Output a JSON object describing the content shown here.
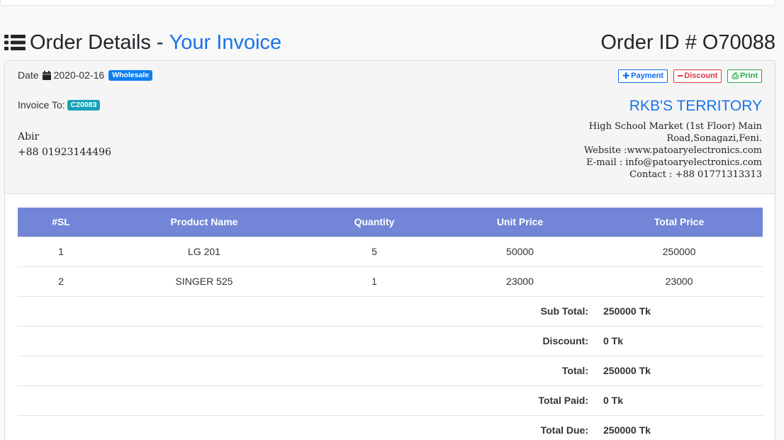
{
  "heading": {
    "title_main": "Order Details - ",
    "title_accent": "Your Invoice",
    "order_id": "Order ID # O70088"
  },
  "invoice": {
    "date_label": "Date",
    "date_value": "2020-02-16",
    "type_badge": "Wholesale",
    "invoice_to_label": "Invoice To:",
    "customer_code": "C20083",
    "customer_name": "Abir",
    "customer_phone": "+88 01923144496"
  },
  "actions": {
    "payment": "Payment",
    "discount": "Discount",
    "print": "Print"
  },
  "company": {
    "name": "RKB'S TERRITORY",
    "address_line1": "High School Market (1st Floor) Main",
    "address_line2": "Road,Sonagazi,Feni.",
    "website": "Website :www.patoaryelectronics.com",
    "email": "E-mail : info@patoaryelectronics.com",
    "contact": "Contact : +88 01771313313"
  },
  "table": {
    "headers": [
      "#SL",
      "Product Name",
      "Quantity",
      "Unit Price",
      "Total Price"
    ],
    "rows": [
      [
        "1",
        "LG 201",
        "5",
        "50000",
        "250000"
      ],
      [
        "2",
        "SINGER 525",
        "1",
        "23000",
        "23000"
      ]
    ]
  },
  "summary": {
    "sub_total_label": "Sub Total:",
    "sub_total_value": "250000 Tk",
    "discount_label": "Discount:",
    "discount_value": "0 Tk",
    "total_label": "Total:",
    "total_value": "250000 Tk",
    "paid_label": "Total Paid:",
    "paid_value": "0 Tk",
    "due_label": "Total Due:",
    "due_value": "250000 Tk"
  },
  "colors": {
    "accent": "#1a73e8",
    "table_header": "#7285d6",
    "badge_wholesale": "#0d7ff0",
    "badge_customer": "#17a2b8"
  },
  "icons": [
    "list-icon",
    "calendar-icon",
    "plus-icon",
    "minus-icon",
    "print-icon"
  ]
}
